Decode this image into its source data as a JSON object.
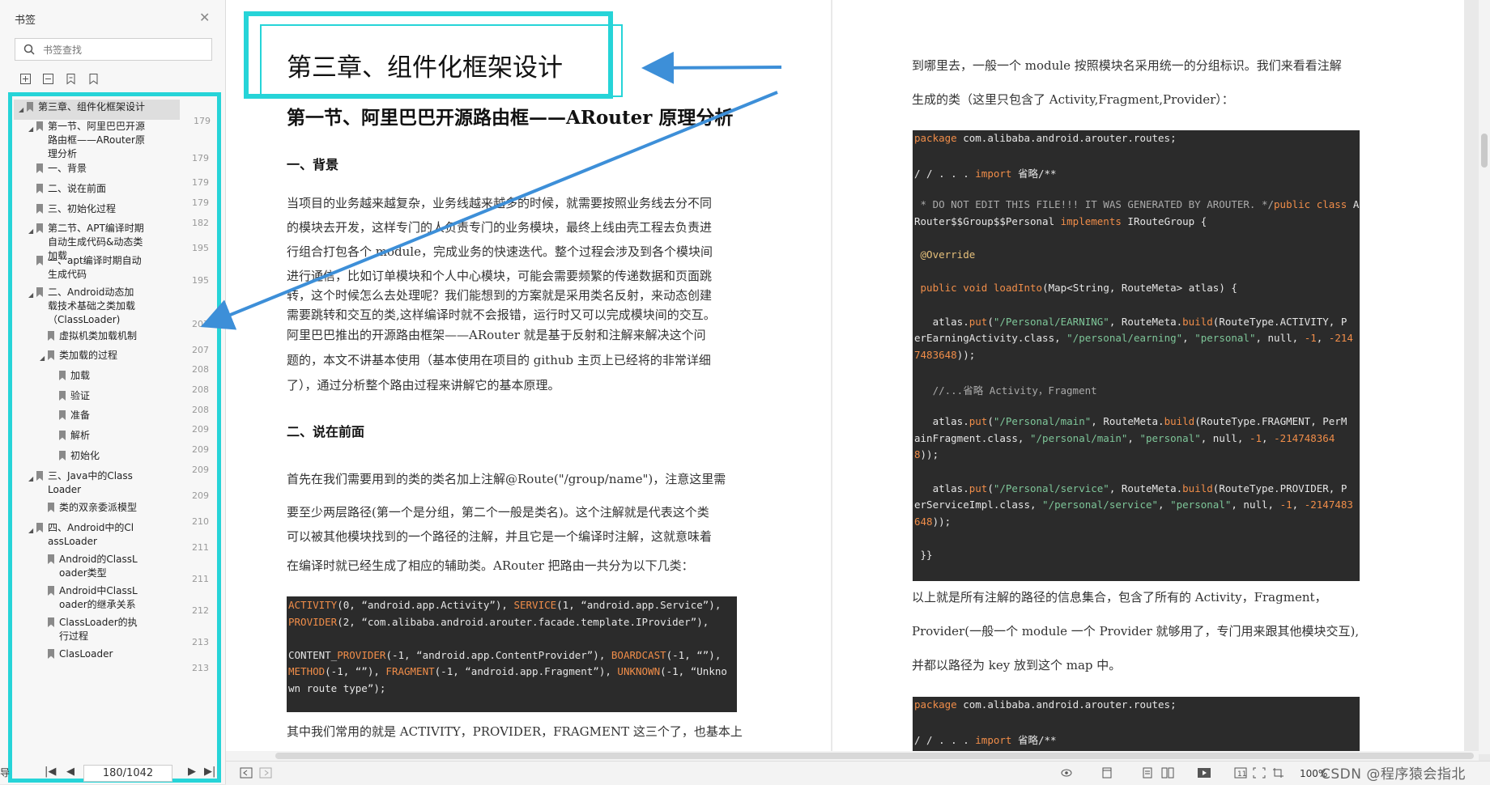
{
  "sidebar": {
    "title": "书签",
    "search_placeholder": "书签查找",
    "toc": [
      {
        "label": "第三章、组件化框架设计",
        "page": "179"
      },
      {
        "label": "第一节、阿里巴巴开源路由框——ARouter原理分析",
        "page": "179"
      },
      {
        "label": "一、背景",
        "page": "179"
      },
      {
        "label": "二、说在前面",
        "page": "179"
      },
      {
        "label": "三、初始化过程",
        "page": "182"
      },
      {
        "label": "第二节、APT编译时期自动生成代码&动态类加载",
        "page": "195"
      },
      {
        "label": "一、apt编译时期自动生成代码",
        "page": "195"
      },
      {
        "label": "二、Android动态加载技术基础之类加载（ClassLoader)",
        "page": "207"
      },
      {
        "label": "虚拟机类加载机制",
        "page": "207"
      },
      {
        "label": "类加载的过程",
        "page": "208"
      },
      {
        "label": "加载",
        "page": "208"
      },
      {
        "label": "验证",
        "page": "208"
      },
      {
        "label": "准备",
        "page": "209"
      },
      {
        "label": "解析",
        "page": "209"
      },
      {
        "label": "初始化",
        "page": "209"
      },
      {
        "label": "三、Java中的ClassLoader",
        "page": "209"
      },
      {
        "label": "类的双亲委派模型",
        "page": "210"
      },
      {
        "label": "四、Android中的ClassLoader",
        "page": "211"
      },
      {
        "label": "Android的ClassLoader类型",
        "page": "211"
      },
      {
        "label": "Android中ClassLoader的继承关系",
        "page": "212"
      },
      {
        "label": "ClassLoader的执行过程",
        "page": "213"
      },
      {
        "label": "ClasLoader",
        "page": "213"
      }
    ],
    "page_indicator": "180/1042",
    "footer_left": "导"
  },
  "left_page": {
    "chapter_title": "第三章、组件化框架设计",
    "section_title": "第一节、阿里巴巴开源路由框——ARouter 原理分析",
    "h1": "一、背景",
    "p1": [
      "当项目的业务越来越复杂，业务线越来越多的时候，就需要按照业务线去分不同",
      "的模块去开发，这样专门的人负责专门的业务模块，最终上线由壳工程去负责进",
      "行组合打包各个 module，完成业务的快速迭代。整个过程会涉及到各个模块间",
      "进行通信，比如订单模块和个人中心模块，可能会需要频繁的传递数据和页面跳",
      "转，这个时候怎么去处理呢？我们能想到的方案就是采用类名反射，来动态创建",
      "需要跳转和交互的类,这样编译时就不会报错，运行时又可以完成模块间的交互。",
      "阿里巴巴推出的开源路由框架——ARouter 就是基于反射和注解来解决这个问",
      "题的，本文不讲基本使用（基本使用在项目的 github 主页上已经将的非常详细",
      "了），通过分析整个路由过程来讲解它的基本原理。"
    ],
    "h2": "二、说在前面",
    "p2": [
      "首先在我们需要用到的类的类名加上注解@Route(\"/group/name\")，注意这里需",
      "要至少两层路径(第一个是分组，第二个一般是类名)。这个注解就是代表这个类",
      "可以被其他模块找到的一个路径的注解，并且它是一个编译时注解，这就意味着",
      "在编译时就已经生成了相应的辅助类。ARouter 把路由一共分为以下几类："
    ],
    "code1": [
      [
        [
          "kw",
          "ACTIVITY"
        ],
        [
          "t",
          "(0, “android.app.Activity”), "
        ],
        [
          "kw",
          "SERVICE"
        ],
        [
          "t",
          "(1, “android.app.Service”),"
        ]
      ],
      [
        [
          "kw",
          "PROVIDER"
        ],
        [
          "t",
          "(2, “com.alibaba.android.arouter.facade.template.IProvider”),"
        ]
      ],
      [
        [
          "t",
          ""
        ]
      ],
      [
        [
          "t",
          "CONTENT_"
        ],
        [
          "kw",
          "PROVIDER"
        ],
        [
          "t",
          "(-1, “android.app.ContentProvider”), "
        ],
        [
          "kw",
          "BOARDCAST"
        ],
        [
          "t",
          "(-1, “”),"
        ]
      ],
      [
        [
          "kw",
          "METHOD"
        ],
        [
          "t",
          "(-1, “”), "
        ],
        [
          "kw",
          "FRAGMENT"
        ],
        [
          "t",
          "(-1, “android.app.Fragment”), "
        ],
        [
          "kw",
          "UNKNOWN"
        ],
        [
          "t",
          "(-1, “Unkno"
        ]
      ],
      [
        [
          "t",
          "wn route type”);"
        ]
      ]
    ],
    "p3": "其中我们常用的就是 ACTIVITY，PROVIDER，FRAGMENT 这三个了，也基本上"
  },
  "right_page": {
    "p1": [
      "到哪里去，一般一个 module 按照模块名采用统一的分组标识。我们来看看注解",
      "生成的类（这里只包含了 Activity,Fragment,Provider）："
    ],
    "code1": [
      [
        [
          "kw",
          "package"
        ],
        [
          "t",
          " com.alibaba.android.arouter.routes;"
        ]
      ],
      [
        [
          "t",
          ""
        ]
      ],
      [
        [
          "t",
          "/ / . . . "
        ],
        [
          "kw",
          "import"
        ],
        [
          "t",
          " 省略/**"
        ]
      ],
      [
        [
          "t",
          ""
        ]
      ],
      [
        [
          "cm",
          " * DO NOT EDIT THIS FILE!!! IT WAS GENERATED BY AROUTER. */"
        ],
        [
          "kw",
          "public"
        ],
        [
          "t",
          " "
        ],
        [
          "kw",
          "class"
        ],
        [
          "t",
          " A"
        ]
      ],
      [
        [
          "t",
          "Router$$Group$$Personal "
        ],
        [
          "kw",
          "implements"
        ],
        [
          "t",
          " IRouteGroup {"
        ]
      ],
      [
        [
          "t",
          ""
        ]
      ],
      [
        [
          "ann",
          " @Override"
        ]
      ],
      [
        [
          "t",
          ""
        ]
      ],
      [
        [
          "kw",
          " public"
        ],
        [
          "t",
          " "
        ],
        [
          "kw",
          "void"
        ],
        [
          "t",
          " "
        ],
        [
          "fn",
          "loadInto"
        ],
        [
          "t",
          "(Map<String, RouteMeta> atlas) {"
        ]
      ],
      [
        [
          "t",
          ""
        ]
      ],
      [
        [
          "t",
          "   atlas."
        ],
        [
          "fn",
          "put"
        ],
        [
          "t",
          "("
        ],
        [
          "str",
          "\"/Personal/EARNING\""
        ],
        [
          "t",
          ", RouteMeta."
        ],
        [
          "fn",
          "build"
        ],
        [
          "t",
          "(RouteType.ACTIVITY, P"
        ]
      ],
      [
        [
          "t",
          "erEarningActivity.class, "
        ],
        [
          "str",
          "\"/personal/earning\""
        ],
        [
          "t",
          ", "
        ],
        [
          "str",
          "\"personal\""
        ],
        [
          "t",
          ", null, "
        ],
        [
          "num",
          "-1"
        ],
        [
          "t",
          ", "
        ],
        [
          "num",
          "-214"
        ]
      ],
      [
        [
          "num",
          "7483648"
        ],
        [
          "t",
          "));"
        ]
      ],
      [
        [
          "t",
          ""
        ]
      ],
      [
        [
          "cm",
          "   //...省略 Activity，Fragment"
        ]
      ],
      [
        [
          "t",
          ""
        ]
      ],
      [
        [
          "t",
          "   atlas."
        ],
        [
          "fn",
          "put"
        ],
        [
          "t",
          "("
        ],
        [
          "str",
          "\"/Personal/main\""
        ],
        [
          "t",
          ", RouteMeta."
        ],
        [
          "fn",
          "build"
        ],
        [
          "t",
          "(RouteType.FRAGMENT, PerM"
        ]
      ],
      [
        [
          "t",
          "ainFragment.class, "
        ],
        [
          "str",
          "\"/personal/main\""
        ],
        [
          "t",
          ", "
        ],
        [
          "str",
          "\"personal\""
        ],
        [
          "t",
          ", null, "
        ],
        [
          "num",
          "-1"
        ],
        [
          "t",
          ", "
        ],
        [
          "num",
          "-214748364"
        ]
      ],
      [
        [
          "num",
          "8"
        ],
        [
          "t",
          "));"
        ]
      ],
      [
        [
          "t",
          ""
        ]
      ],
      [
        [
          "t",
          "   atlas."
        ],
        [
          "fn",
          "put"
        ],
        [
          "t",
          "("
        ],
        [
          "str",
          "\"/Personal/service\""
        ],
        [
          "t",
          ", RouteMeta."
        ],
        [
          "fn",
          "build"
        ],
        [
          "t",
          "(RouteType.PROVIDER, P"
        ]
      ],
      [
        [
          "t",
          "erServiceImpl.class, "
        ],
        [
          "str",
          "\"/personal/service\""
        ],
        [
          "t",
          ", "
        ],
        [
          "str",
          "\"personal\""
        ],
        [
          "t",
          ", null, "
        ],
        [
          "num",
          "-1"
        ],
        [
          "t",
          ", "
        ],
        [
          "num",
          "-2147483"
        ]
      ],
      [
        [
          "num",
          "648"
        ],
        [
          "t",
          "));"
        ]
      ],
      [
        [
          "t",
          ""
        ]
      ],
      [
        [
          "t",
          " }}"
        ]
      ]
    ],
    "p2": [
      "以上就是所有注解的路径的信息集合，包含了所有的 Activity，Fragment，",
      "Provider(一般一个 module 一个 Provider 就够用了，专门用来跟其他模块交互),",
      "并都以路径为 key 放到这个 map 中。"
    ],
    "code2": [
      [
        [
          "kw",
          "package"
        ],
        [
          "t",
          " com.alibaba.android.arouter.routes;"
        ]
      ],
      [
        [
          "t",
          ""
        ]
      ],
      [
        [
          "t",
          "/ / . . . "
        ],
        [
          "kw",
          "import"
        ],
        [
          "t",
          " 省略/**"
        ]
      ]
    ]
  },
  "statusbar": {
    "zoom": "100%",
    "watermark": "CSDN @程序猿会指北"
  },
  "colors": {
    "highlight_frame": "#26d4d8",
    "arrow": "#3d8fd8",
    "code_bg": "#2b2b2b"
  }
}
